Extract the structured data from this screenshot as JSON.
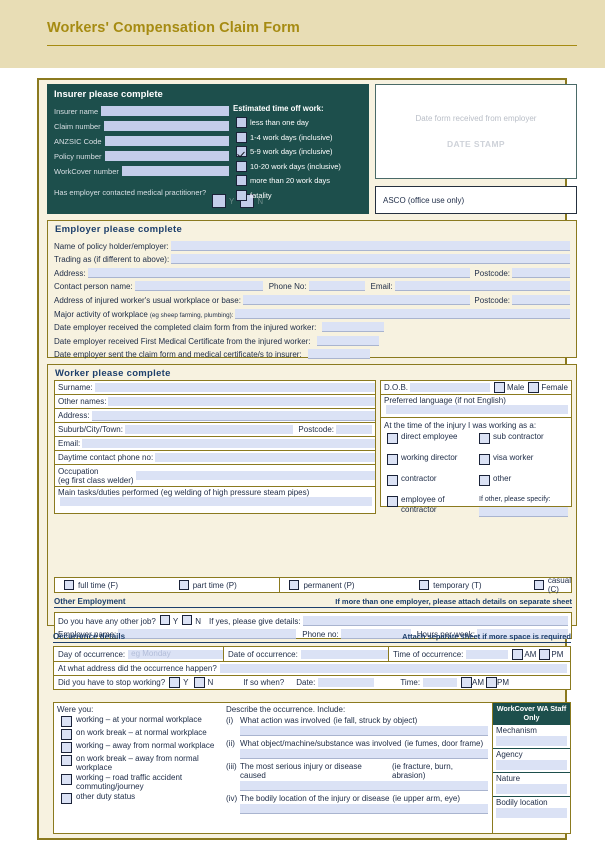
{
  "header": {
    "title": "Workers' Compensation Claim Form"
  },
  "insurer": {
    "heading": "Insurer please complete",
    "fields": [
      {
        "label": "Insurer name",
        "value": ""
      },
      {
        "label": "Claim number",
        "value": ""
      },
      {
        "label": "ANZSIC Code",
        "value": ""
      },
      {
        "label": "Policy number",
        "value": ""
      },
      {
        "label": "WorkCover number",
        "value": ""
      }
    ],
    "contact_question": "Has employer contacted medical practitioner?",
    "yes_label": "Y",
    "no_label": "N",
    "time_off_heading": "Estimated time off work:",
    "time_off_options": [
      {
        "label": "less than one day",
        "checked": false
      },
      {
        "label": "1-4 work days (inclusive)",
        "checked": false
      },
      {
        "label": "5-9 work days (inclusive)",
        "checked": true
      },
      {
        "label": "10-20 work days (inclusive)",
        "checked": false
      },
      {
        "label": "more than 20 work days",
        "checked": false
      },
      {
        "label": "fatality",
        "checked": false
      }
    ]
  },
  "stamp": {
    "line1": "Date form received from employer",
    "line2": "DATE STAMP",
    "asco": "ASCO (office use only)"
  },
  "employer": {
    "heading": "Employer please complete",
    "name_label": "Name of policy holder/employer:",
    "trading_label": "Trading as (if different to above):",
    "address_label": "Address:",
    "postcode_label": "Postcode:",
    "contact_label": "Contact person name:",
    "phone_label": "Phone No:",
    "email_label": "Email:",
    "workplace_label": "Address of injured worker's usual workplace or base:",
    "activity_label": "Major activity of workplace",
    "activity_hint": "(eg sheep farming, plumbing):",
    "date_received_claim": "Date employer received the completed claim form from the injured worker:",
    "date_received_cert": "Date employer received First Medical Certificate from the injured worker:",
    "date_sent": "Date employer sent the claim form and medical certificate/s to insurer:"
  },
  "worker": {
    "heading": "Worker please complete",
    "surname_label": "Surname:",
    "other_names_label": "Other names:",
    "address_label": "Address:",
    "suburb_label": "Suburb/City/Town:",
    "postcode_label": "Postcode:",
    "email_label": "Email:",
    "phone_label": "Daytime contact phone no:",
    "occupation_label": "Occupation",
    "occupation_hint": "(eg first class welder)",
    "tasks_label": "Main tasks/duties performed",
    "tasks_hint": "(eg welding of high pressure steam pipes)",
    "dob_label": "D.O.B.",
    "male_label": "Male",
    "female_label": "Female",
    "language_label": "Preferred language",
    "language_hint": "(if not English)",
    "working_as_heading": "At the time of the injury I was working as a:",
    "working_as_options": [
      "direct employee",
      "sub contractor",
      "working director",
      "visa worker",
      "contractor",
      "other",
      "employee of contractor"
    ],
    "if_other_label": "If other, please specify:",
    "status_options": [
      "full time (F)",
      "part time (P)",
      "permanent (P)",
      "temporary (T)",
      "casual (C)"
    ]
  },
  "other_employment": {
    "title": "Other Employment",
    "note": "If more than one employer, please attach details on separate sheet",
    "question": "Do you have any other job?",
    "yes_label": "Y",
    "no_label": "N",
    "if_yes_label": "If yes, please give details:",
    "employer_name_label": "Employer name:",
    "phone_label": "Phone no:",
    "hours_label": "Hours per week:"
  },
  "occurrence": {
    "title": "Occurrence details",
    "note": "Attach separate sheet if more space is required",
    "day_label": "Day of occurrence:",
    "day_placeholder": "eg Monday",
    "date_label": "Date of occurrence:",
    "time_label": "Time of occurrence:",
    "am_label": "AM",
    "pm_label": "PM",
    "address_label": "At what address did the occurrence happen?",
    "stop_label": "Did you have to stop working?",
    "yes_label": "Y",
    "no_label": "N",
    "if_so_label": "If so when?",
    "stop_date_label": "Date:",
    "stop_time_label": "Time:",
    "were_you_heading": "Were you:",
    "were_you_options": [
      "working – at your normal workplace",
      "on work break – at normal workplace",
      "working – away from normal workplace",
      "on work break – away from normal workplace",
      "working – road traffic accident commuting/journey",
      "other duty status"
    ],
    "describe_heading": "Describe the occurrence. Include:",
    "describe_items": [
      {
        "num": "(i)",
        "text": "What action was involved",
        "hint": "(ie fall, struck by object)"
      },
      {
        "num": "(ii)",
        "text": "What object/machine/substance was involved",
        "hint": "(ie fumes, door frame)"
      },
      {
        "num": "(iii)",
        "text": "The most serious injury or disease caused",
        "hint": "(ie fracture, burn, abrasion)"
      },
      {
        "num": "(iv)",
        "text": "The bodily location of the injury or disease",
        "hint": "(ie upper arm, eye)"
      }
    ]
  },
  "staff_only": {
    "heading": "WorkCover WA Staff Only",
    "items": [
      "Mechanism",
      "Agency",
      "Nature",
      "Bodily location"
    ]
  }
}
